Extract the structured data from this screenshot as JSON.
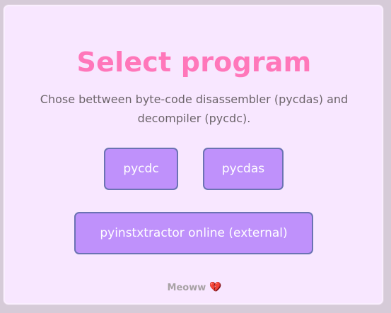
{
  "page": {
    "title": "Select program",
    "description": "Chose bettween byte-code disassembler (pycdas) and decompiler (pycdc).",
    "buttons": {
      "pycdc": "pycdc",
      "pycdas": "pycdas",
      "external": "pyinstxtractor online (external)"
    },
    "footer": {
      "text": "Meoww",
      "heart_icon": "broken-heart-icon",
      "heart_glyph": "💔"
    }
  },
  "colors": {
    "background": "#f8e7ff",
    "title": "#ff77ba",
    "button_fill": "#bf91fb",
    "button_border": "#6b73b3",
    "body_text": "#6d656b",
    "footer_text": "#a8a2a5"
  }
}
